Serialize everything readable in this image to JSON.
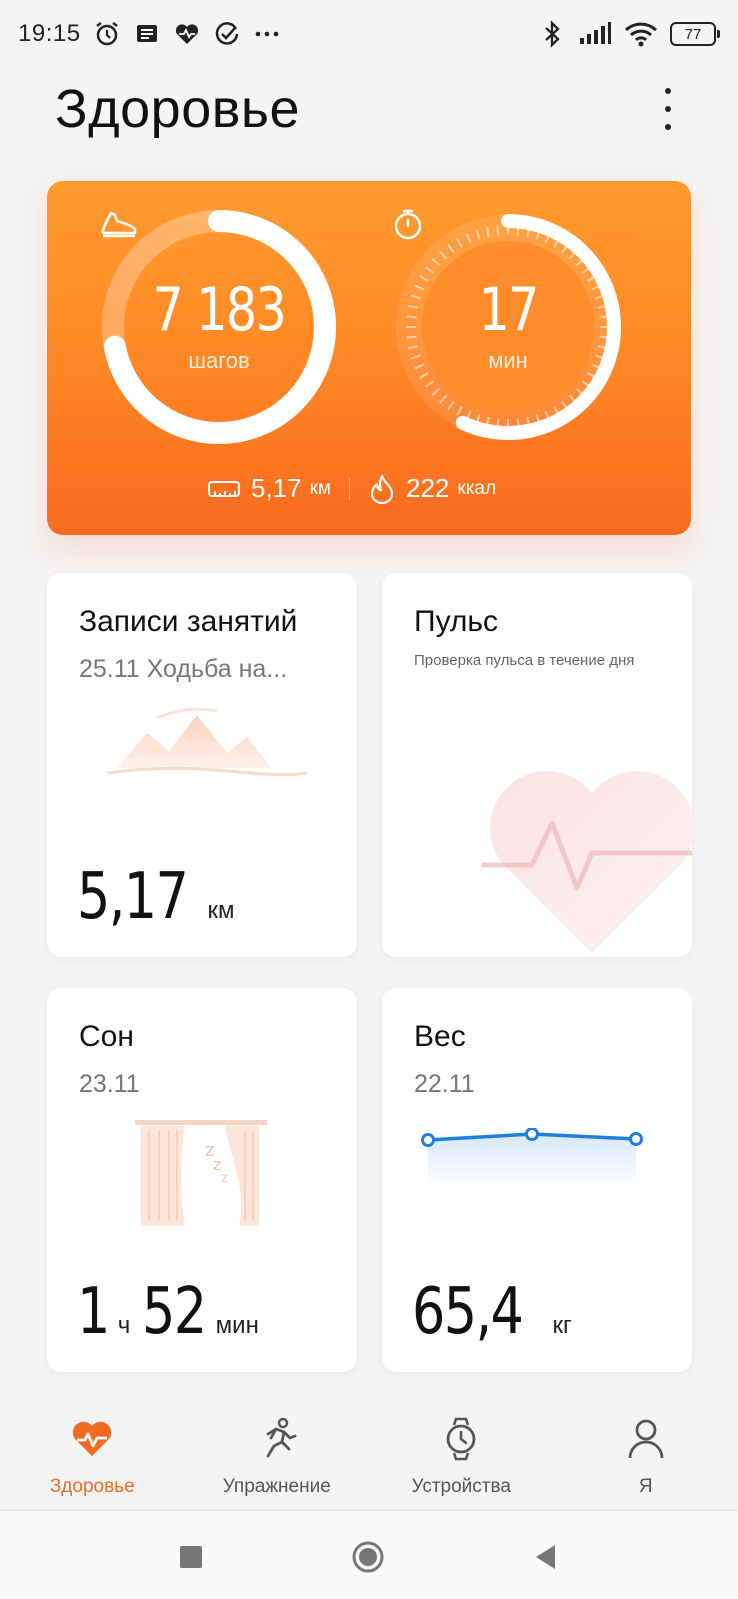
{
  "status_bar": {
    "time": "19:15",
    "battery": "77",
    "icons": [
      "alarm-icon",
      "message-icon",
      "health-icon",
      "check-circle-icon",
      "more-dots-icon",
      "bluetooth-icon",
      "signal-icon",
      "wifi-icon",
      "battery-icon"
    ]
  },
  "header": {
    "title": "Здоровье"
  },
  "activity": {
    "steps_value": "7 183",
    "steps_unit": "шагов",
    "steps_progress": 0.72,
    "minutes_value": "17",
    "minutes_unit": "мин",
    "minutes_progress": 0.57,
    "distance_value": "5,17",
    "distance_unit": "км",
    "calories_value": "222",
    "calories_unit": "ккал",
    "colors": {
      "gradient_top": "#ff9b30",
      "gradient_bottom": "#fa6a1f"
    }
  },
  "tiles": {
    "workouts": {
      "title": "Записи занятий",
      "subtitle": "25.11 Ходьба на...",
      "value": "5,17",
      "unit": "км"
    },
    "pulse": {
      "title": "Пульс",
      "subtitle": "Проверка пульса в течение дня"
    },
    "sleep": {
      "title": "Сон",
      "date": "23.11",
      "hours": "1",
      "hours_unit": "ч",
      "minutes": "52",
      "minutes_unit": "мин"
    },
    "weight": {
      "title": "Вес",
      "date": "22.11",
      "value": "65,4",
      "unit": "кг",
      "trend_color": "#1e7fe0"
    }
  },
  "bottom_nav": {
    "items": [
      {
        "label": "Здоровье",
        "icon": "heart-pulse-icon",
        "active": true
      },
      {
        "label": "Упражнение",
        "icon": "running-icon",
        "active": false
      },
      {
        "label": "Устройства",
        "icon": "watch-icon",
        "active": false
      },
      {
        "label": "Я",
        "icon": "user-icon",
        "active": false
      }
    ],
    "active_color": "#f06a20"
  },
  "system_nav": {
    "icons": [
      "recents-square-icon",
      "home-circle-icon",
      "back-triangle-icon"
    ]
  }
}
